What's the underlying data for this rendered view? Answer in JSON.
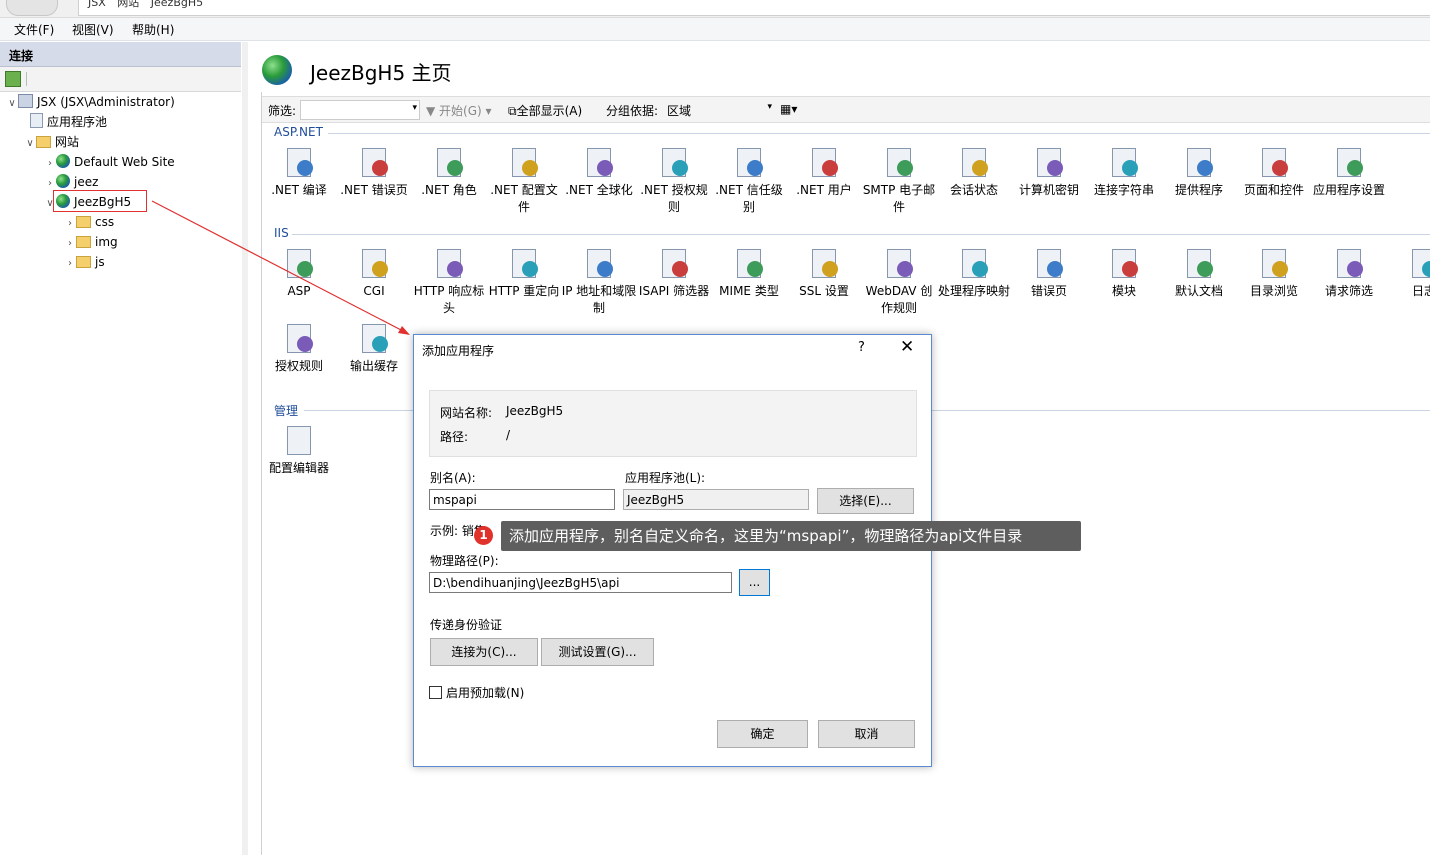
{
  "address_bar": {
    "crumbs": [
      "JSX",
      "网站",
      "JeezBgH5"
    ]
  },
  "menu": {
    "file": "文件(F)",
    "view": "视图(V)",
    "help": "帮助(H)"
  },
  "connections": {
    "title": "连接",
    "tree": {
      "server": "JSX (JSX\\Administrator)",
      "app_pools": "应用程序池",
      "sites": "网站",
      "default_site": "Default Web Site",
      "jeez": "jeez",
      "selected_site": "JeezBgH5",
      "css": "css",
      "img": "img",
      "js": "js"
    }
  },
  "main": {
    "title": "JeezBgH5 主页",
    "filter": {
      "label": "筛选:",
      "go": "开始(G)",
      "show_all": "全部显示(A)",
      "group_by": "分组依据:",
      "group_value": "区域"
    },
    "aspnet": {
      "header": "ASP.NET",
      "features": [
        ".NET 编译",
        ".NET 错误页",
        ".NET 角色",
        ".NET 配置文件",
        ".NET 全球化",
        ".NET 授权规则",
        ".NET 信任级别",
        ".NET 用户",
        "SMTP 电子邮件",
        "会话状态",
        "计算机密钥",
        "连接字符串",
        "提供程序",
        "页面和控件",
        "应用程序设置"
      ]
    },
    "iis": {
      "header": "IIS",
      "features": [
        "ASP",
        "CGI",
        "HTTP 响应标头",
        "HTTP 重定向",
        "IP 地址和域限制",
        "ISAPI 筛选器",
        "MIME 类型",
        "SSL 设置",
        "WebDAV 创作规则",
        "处理程序映射",
        "错误页",
        "模块",
        "默认文档",
        "目录浏览",
        "请求筛选",
        "日志"
      ],
      "features_row2": [
        "授权规则",
        "输出缓存"
      ]
    },
    "management": {
      "header": "管理",
      "features": [
        "配置编辑器"
      ]
    }
  },
  "dialog": {
    "title": "添加应用程序",
    "help": "?",
    "close": "✕",
    "site_name_label": "网站名称:",
    "site_name": "JeezBgH5",
    "path_label": "路径:",
    "path": "/",
    "alias_label": "别名(A):",
    "alias_value": "mspapi",
    "app_pool_label": "应用程序池(L):",
    "app_pool_value": "JeezBgH5",
    "select_button": "选择(E)...",
    "example": "示例: 销售",
    "physical_path_label": "物理路径(P):",
    "physical_path_value": "D:\\bendihuanjing\\JeezBgH5\\api",
    "browse_button": "...",
    "pass_through_label": "传递身份验证",
    "connect_as_button": "连接为(C)...",
    "test_settings_button": "测试设置(G)...",
    "preload_label": "启用预加载(N)",
    "ok_button": "确定",
    "cancel_button": "取消"
  },
  "annotation": {
    "badge": "1",
    "text": "添加应用程序，别名自定义命名，这里为“mspapi”，物理路径为api文件目录",
    "colors": {
      "badge": "#e0322b",
      "tooltip_bg": "#5e5e5e",
      "highlight": "#e03030"
    }
  }
}
